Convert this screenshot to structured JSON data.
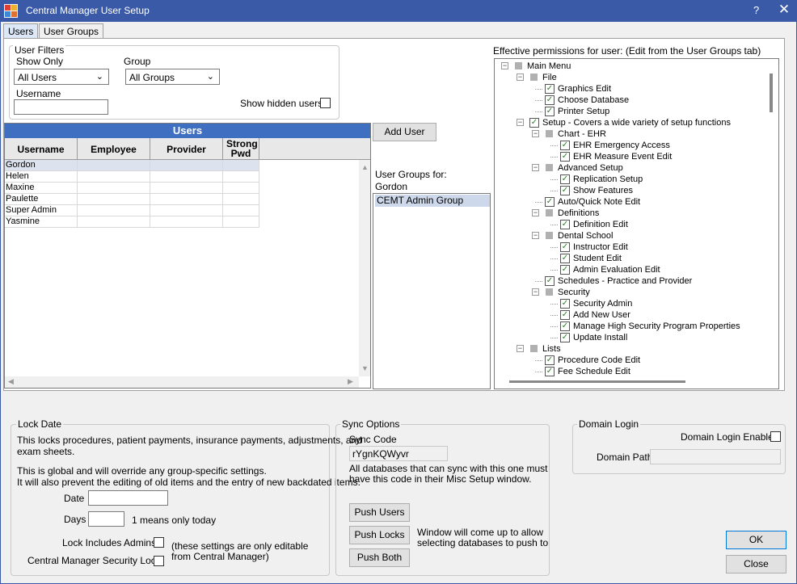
{
  "window": {
    "title": "Central Manager User Setup",
    "help": "?",
    "close": "✕"
  },
  "tabs": [
    {
      "label": "Users"
    },
    {
      "label": "User Groups"
    }
  ],
  "user_filters": {
    "legend": "User Filters",
    "show_only_label": "Show Only",
    "show_only_value": "All Users",
    "group_label": "Group",
    "group_value": "All Groups",
    "username_label": "Username",
    "username_value": "",
    "show_hidden_label": "Show hidden users"
  },
  "users_grid": {
    "title": "Users",
    "columns": [
      "Username",
      "Employee",
      "Provider",
      "Strong Pwd"
    ],
    "rows": [
      "Gordon",
      "Helen",
      "Maxine",
      "Paulette",
      "Super Admin",
      "Yasmine"
    ]
  },
  "add_user_label": "Add User",
  "user_groups": {
    "label": "User Groups for:",
    "user": "Gordon",
    "items": [
      "CEMT Admin Group"
    ]
  },
  "permissions": {
    "label": "Effective permissions for user: (Edit from the User Groups tab)",
    "nodes": [
      {
        "label": "Main Menu",
        "level": 0,
        "expander": true,
        "box": "partial"
      },
      {
        "label": "File",
        "level": 1,
        "expander": true,
        "box": "partial"
      },
      {
        "label": "Graphics Edit",
        "level": 2,
        "expander": false,
        "box": "checked"
      },
      {
        "label": "Choose Database",
        "level": 2,
        "expander": false,
        "box": "checked"
      },
      {
        "label": "Printer Setup",
        "level": 2,
        "expander": false,
        "box": "checked"
      },
      {
        "label": "Setup - Covers a wide variety of setup functions",
        "level": 1,
        "expander": true,
        "box": "checked"
      },
      {
        "label": "Chart - EHR",
        "level": 2,
        "expander": true,
        "box": "partial"
      },
      {
        "label": "EHR Emergency Access",
        "level": 3,
        "expander": false,
        "box": "checked"
      },
      {
        "label": "EHR Measure Event Edit",
        "level": 3,
        "expander": false,
        "box": "checked"
      },
      {
        "label": "Advanced Setup",
        "level": 2,
        "expander": true,
        "box": "partial"
      },
      {
        "label": "Replication Setup",
        "level": 3,
        "expander": false,
        "box": "checked"
      },
      {
        "label": "Show Features",
        "level": 3,
        "expander": false,
        "box": "checked"
      },
      {
        "label": "Auto/Quick Note Edit",
        "level": 2,
        "expander": false,
        "box": "checked"
      },
      {
        "label": "Definitions",
        "level": 2,
        "expander": true,
        "box": "partial"
      },
      {
        "label": "Definition Edit",
        "level": 3,
        "expander": false,
        "box": "checked"
      },
      {
        "label": "Dental School",
        "level": 2,
        "expander": true,
        "box": "partial"
      },
      {
        "label": "Instructor Edit",
        "level": 3,
        "expander": false,
        "box": "checked"
      },
      {
        "label": "Student Edit",
        "level": 3,
        "expander": false,
        "box": "checked"
      },
      {
        "label": "Admin Evaluation Edit",
        "level": 3,
        "expander": false,
        "box": "checked"
      },
      {
        "label": "Schedules - Practice and Provider",
        "level": 2,
        "expander": false,
        "box": "checked"
      },
      {
        "label": "Security",
        "level": 2,
        "expander": true,
        "box": "partial"
      },
      {
        "label": "Security Admin",
        "level": 3,
        "expander": false,
        "box": "checked"
      },
      {
        "label": "Add New User",
        "level": 3,
        "expander": false,
        "box": "checked"
      },
      {
        "label": "Manage High Security Program Properties",
        "level": 3,
        "expander": false,
        "box": "checked"
      },
      {
        "label": "Update Install",
        "level": 3,
        "expander": false,
        "box": "checked"
      },
      {
        "label": "Lists",
        "level": 1,
        "expander": true,
        "box": "partial"
      },
      {
        "label": "Procedure Code Edit",
        "level": 2,
        "expander": false,
        "box": "checked"
      },
      {
        "label": "Fee Schedule Edit",
        "level": 2,
        "expander": false,
        "box": "checked"
      }
    ]
  },
  "lock_date": {
    "legend": "Lock Date",
    "desc1": "This locks procedures, patient payments, insurance payments, adjustments, and",
    "desc1b": "exam sheets.",
    "desc2": "This is global and will override any group-specific settings.",
    "desc3": "It will also prevent the editing of old items and the entry of new backdated items.",
    "date_label": "Date",
    "days_label": "Days",
    "days_hint": "1 means only today",
    "lock_admins_label": "Lock Includes Admins",
    "cm_lock_label": "Central Manager Security Lock",
    "note1": "(these settings are only editable",
    "note2": "from Central Manager)"
  },
  "sync": {
    "legend": "Sync Options",
    "code_label": "Sync Code",
    "code_value": "rYgnKQWyvr",
    "desc1": "All databases that can sync with this one must",
    "desc2": "have this code in their Misc Setup window.",
    "push_users": "Push Users",
    "push_locks": "Push Locks",
    "push_both": "Push Both",
    "push_note1": "Window will come up to allow",
    "push_note2": "selecting databases to push to"
  },
  "domain": {
    "legend": "Domain Login",
    "enabled_label": "Domain Login Enabled",
    "path_label": "Domain Path",
    "path_value": ""
  },
  "ok_label": "OK",
  "close_label": "Close"
}
